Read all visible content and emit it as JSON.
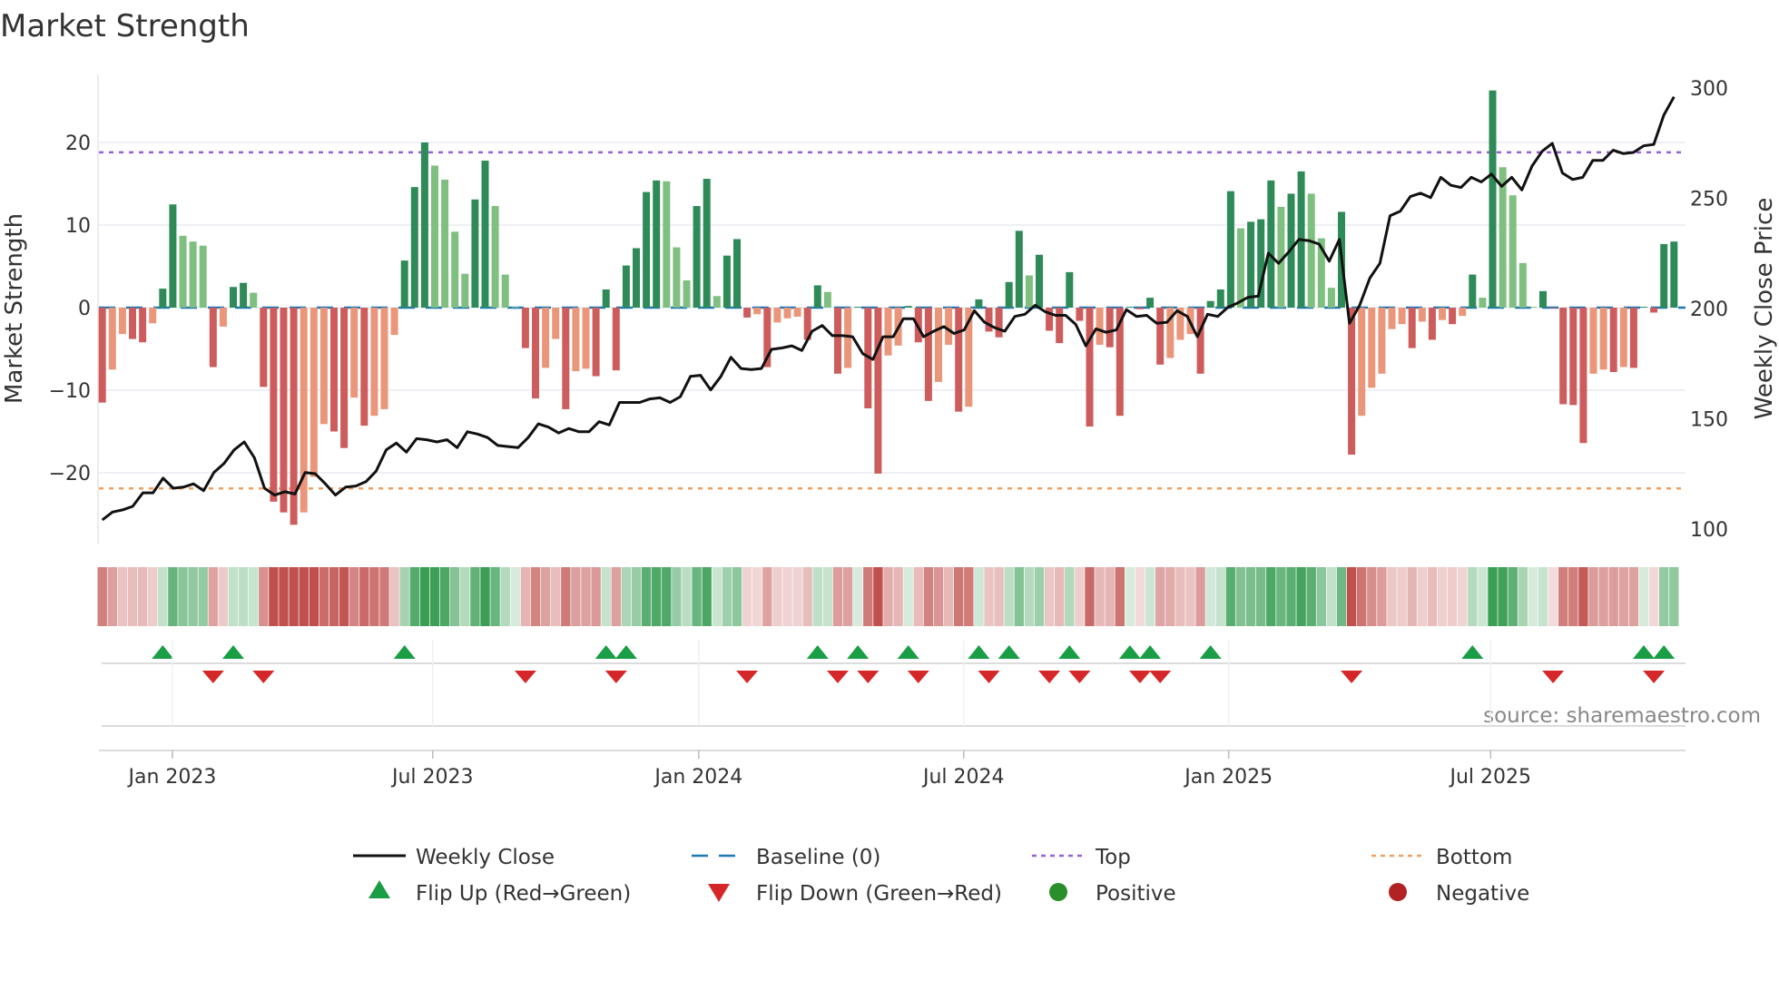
{
  "title": "Market Strength",
  "source": "source: sharemaestro.com",
  "chart_data": {
    "type": "bar",
    "title": "Market Strength",
    "ylabel": "Market Strength",
    "y2label": "Weekly Close Price",
    "ylim": [
      -28.7,
      28.5
    ],
    "y2lim": [
      93,
      307
    ],
    "yticks": [
      "20",
      "10",
      "0",
      "−10",
      "−20"
    ],
    "ytick_values": [
      20,
      10,
      0,
      -10,
      -20
    ],
    "y2ticks": [
      "300",
      "250",
      "200",
      "150",
      "100"
    ],
    "y2tick_values": [
      300,
      250,
      200,
      150,
      100
    ],
    "x_ticks": [
      {
        "label": "Jan 2023",
        "week": 6.96
      },
      {
        "label": "Jul 2023",
        "week": 32.8
      },
      {
        "label": "Jan 2024",
        "week": 59.2
      },
      {
        "label": "Jul 2024",
        "week": 85.5
      },
      {
        "label": "Jan 2025",
        "week": 111.8
      },
      {
        "label": "Jul 2025",
        "week": 137.8
      }
    ],
    "top_level": 18.8,
    "bottom_level": -21.9,
    "baseline": 0,
    "strength": [
      -11.5,
      -7.5,
      -3.2,
      -3.8,
      -4.2,
      -1.9,
      2.3,
      12.5,
      8.7,
      8.0,
      7.5,
      -7.2,
      -2.3,
      2.5,
      3.0,
      1.8,
      -9.6,
      -23.5,
      -24.8,
      -26.3,
      -24.8,
      -20.5,
      -14.1,
      -15.0,
      -17.0,
      -10.9,
      -14.3,
      -13.1,
      -12.3,
      -3.3,
      5.7,
      14.6,
      20.0,
      17.2,
      15.5,
      9.2,
      4.1,
      13.1,
      17.8,
      12.3,
      4.0,
      0.1,
      -4.9,
      -11.0,
      -7.3,
      -3.8,
      -12.3,
      -7.7,
      -7.4,
      -8.3,
      2.2,
      -7.6,
      5.1,
      7.2,
      14.0,
      15.4,
      15.3,
      7.3,
      3.3,
      12.3,
      15.6,
      1.4,
      6.3,
      8.3,
      -1.2,
      -0.8,
      -7.2,
      -1.8,
      -1.3,
      -1.1,
      -3.9,
      2.7,
      1.9,
      -8.0,
      -7.3,
      0.1,
      -12.2,
      -20.1,
      -5.8,
      -4.6,
      0.2,
      -4.2,
      -11.3,
      -9.0,
      -4.5,
      -12.6,
      -12.0,
      1.0,
      -2.9,
      -3.6,
      3.1,
      9.3,
      3.9,
      6.4,
      -2.8,
      -4.3,
      4.3,
      -1.6,
      -14.4,
      -4.5,
      -4.8,
      -13.1,
      0.1,
      -0.2,
      1.2,
      -6.9,
      -6.1,
      -3.9,
      -3.2,
      -8.0,
      0.8,
      2.2,
      14.1,
      9.6,
      10.4,
      10.7,
      15.4,
      12.2,
      13.8,
      16.5,
      13.8,
      8.4,
      2.4,
      11.6,
      -17.8,
      -13.1,
      -9.7,
      -8.0,
      -2.6,
      -2.0,
      -4.9,
      -1.7,
      -3.9,
      -1.5,
      -2.0,
      -1.0,
      4.0,
      1.2,
      26.3,
      17.0,
      13.6,
      5.4,
      0.1,
      2.0,
      -0.1,
      -11.7,
      -11.8,
      -16.4,
      -8.0,
      -7.5,
      -7.8,
      -7.2,
      -7.3,
      0.1,
      -0.6,
      7.7,
      8.0
    ],
    "weekly_close": [
      104.1,
      107.7,
      108.7,
      110.3,
      116.4,
      116.4,
      123.1,
      118.5,
      119.0,
      120.5,
      117.4,
      125.6,
      129.7,
      135.9,
      139.5,
      132.3,
      118.5,
      115.4,
      116.9,
      115.9,
      125.6,
      125.1,
      120.5,
      115.4,
      119.0,
      119.5,
      121.5,
      126.2,
      135.9,
      139.0,
      134.9,
      141.0,
      140.5,
      139.5,
      140.5,
      136.9,
      144.1,
      143.1,
      141.5,
      137.9,
      137.4,
      136.9,
      141.5,
      147.7,
      146.2,
      143.6,
      145.6,
      144.1,
      144.1,
      148.7,
      147.2,
      157.4,
      157.4,
      157.4,
      159.0,
      159.5,
      157.4,
      160.0,
      169.2,
      169.7,
      163.1,
      169.2,
      177.9,
      172.8,
      172.3,
      172.8,
      181.5,
      182.1,
      183.1,
      181.0,
      189.7,
      192.3,
      187.7,
      187.7,
      187.2,
      179.5,
      176.9,
      187.2,
      187.2,
      195.4,
      195.4,
      187.2,
      189.7,
      191.8,
      188.7,
      190.3,
      199.0,
      193.8,
      191.3,
      189.7,
      196.4,
      197.4,
      201.5,
      198.5,
      196.9,
      196.9,
      192.8,
      183.1,
      190.8,
      189.2,
      190.3,
      199.5,
      196.4,
      196.9,
      193.3,
      193.8,
      199.0,
      196.4,
      187.2,
      197.4,
      196.4,
      200.5,
      202.6,
      205.1,
      205.6,
      225.1,
      220.5,
      225.6,
      231.3,
      230.8,
      229.2,
      221.5,
      231.3,
      193.3,
      201.5,
      213.8,
      220.5,
      242.1,
      244.1,
      250.8,
      252.3,
      250.3,
      259.5,
      255.9,
      254.9,
      259.5,
      257.4,
      261.0,
      255.4,
      259.5,
      253.8,
      264.6,
      271.3,
      274.9,
      261.5,
      258.5,
      259.5,
      267.2,
      267.2,
      271.8,
      270.3,
      270.8,
      273.8,
      274.4,
      287.7,
      296.0
    ],
    "flip_up_weeks": [
      7,
      14,
      31,
      51,
      53,
      72,
      76,
      81,
      88,
      91,
      97,
      103,
      105,
      111,
      137,
      154,
      156
    ],
    "flip_down_weeks": [
      12,
      17,
      43,
      52,
      65,
      74,
      77,
      82,
      89,
      95,
      98,
      104,
      106,
      125,
      145,
      155
    ],
    "colors": {
      "strong_up": "#2e8b57",
      "weak_up": "#7fbf7f",
      "strong_down": "#cd5c5c",
      "weak_down": "#e9967a",
      "line": "#111111",
      "baseline": "#1f77b4",
      "top": "#9b5fd6",
      "bottom": "#f0a060",
      "flip_up": "#1a9e45",
      "flip_down": "#d62728",
      "positive": "#2a8f2a",
      "negative": "#b22222"
    },
    "legend": {
      "placement": "bottom",
      "entries": [
        "Weekly Close",
        "Baseline (0)",
        "Top",
        "Bottom",
        "Flip Up (Red→Green)",
        "Flip Down (Green→Red)",
        "Positive",
        "Negative"
      ]
    }
  }
}
